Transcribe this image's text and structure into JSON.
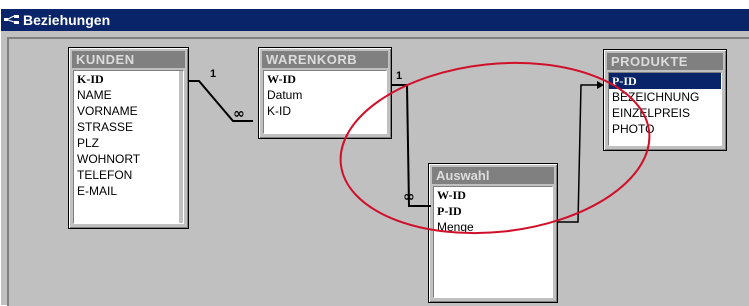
{
  "window": {
    "title": "Beziehungen"
  },
  "tables": {
    "kunden": {
      "title": "KUNDEN",
      "fields": [
        "K-ID",
        "NAME",
        "VORNAME",
        "STRASSE",
        "PLZ",
        "WOHNORT",
        "TELEFON",
        "E-MAIL"
      ]
    },
    "warenkorb": {
      "title": "WARENKORB",
      "fields": [
        "W-ID",
        "Datum",
        "K-ID"
      ]
    },
    "produkte": {
      "title": "PRODUKTE",
      "fields": [
        "P-ID",
        "BEZEICHNUNG",
        "EINZELPREIS",
        "PHOTO"
      ]
    },
    "auswahl": {
      "title": "Auswahl",
      "fields": [
        "W-ID",
        "P-ID",
        "Menge"
      ]
    }
  },
  "relationships": {
    "kunden_warenkorb": {
      "one": "1",
      "many": "∞"
    },
    "warenkorb_auswahl": {
      "one": "1",
      "many": "∞"
    }
  },
  "annotation": {
    "color": "#d0102a"
  }
}
